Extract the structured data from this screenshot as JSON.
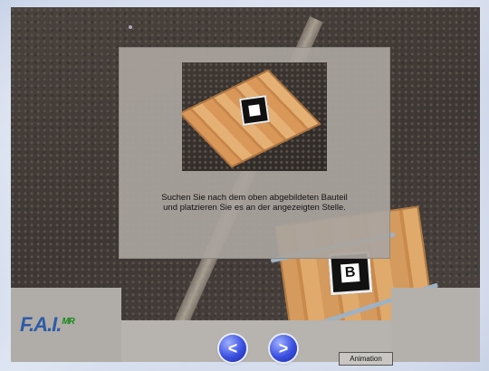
{
  "dialog": {
    "instruction_line1": "Suchen Sie nach dem oben abgebildeten Bauteil",
    "instruction_line2": "und platzieren Sie es an der angezeigten Stelle."
  },
  "marker": {
    "board_letter": "B"
  },
  "logo": {
    "text": "F.A.I.",
    "superscript": "MR"
  },
  "controls": {
    "prev_label": "<",
    "next_label": ">",
    "animation_label": "Animation"
  },
  "colors": {
    "logo_blue": "#2d5ba8",
    "logo_green": "#1b8a1b",
    "nav_button_blue": "#3a4fe0"
  }
}
